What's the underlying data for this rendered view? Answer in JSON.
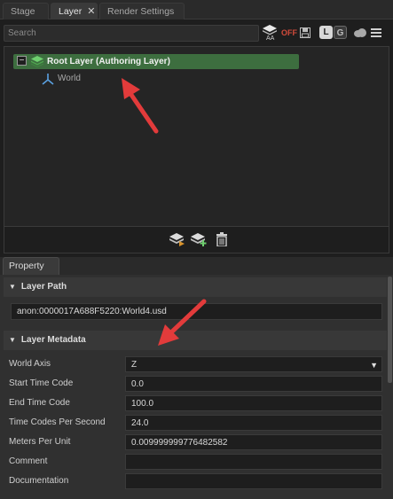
{
  "tabs": [
    {
      "label": "Stage"
    },
    {
      "label": "Layer",
      "close": "✕"
    },
    {
      "label": "Render Settings"
    }
  ],
  "toolbar": {
    "search_placeholder": "Search",
    "aa_label": "AA",
    "off_label": "OFF",
    "l_label": "L",
    "g_label": "G"
  },
  "tree": {
    "expander": "−",
    "root_label": "Root Layer (Authoring Layer)",
    "world_label": "World"
  },
  "property": {
    "tab_label": "Property",
    "layer_path_header": "Layer Path",
    "layer_path_value": "anon:0000017A688F5220:World4.usd",
    "metadata_header": "Layer Metadata",
    "fields": [
      {
        "label": "World Axis",
        "value": "Z"
      },
      {
        "label": "Start Time Code",
        "value": "0.0"
      },
      {
        "label": "End Time Code",
        "value": "100.0"
      },
      {
        "label": "Time Codes Per Second",
        "value": "24.0"
      },
      {
        "label": "Meters Per Unit",
        "value": "0.009999999776482582"
      },
      {
        "label": "Comment",
        "value": ""
      },
      {
        "label": "Documentation",
        "value": ""
      }
    ]
  },
  "colors": {
    "accent_green": "#3d6e3f",
    "arrow_red": "#e23b3b"
  }
}
